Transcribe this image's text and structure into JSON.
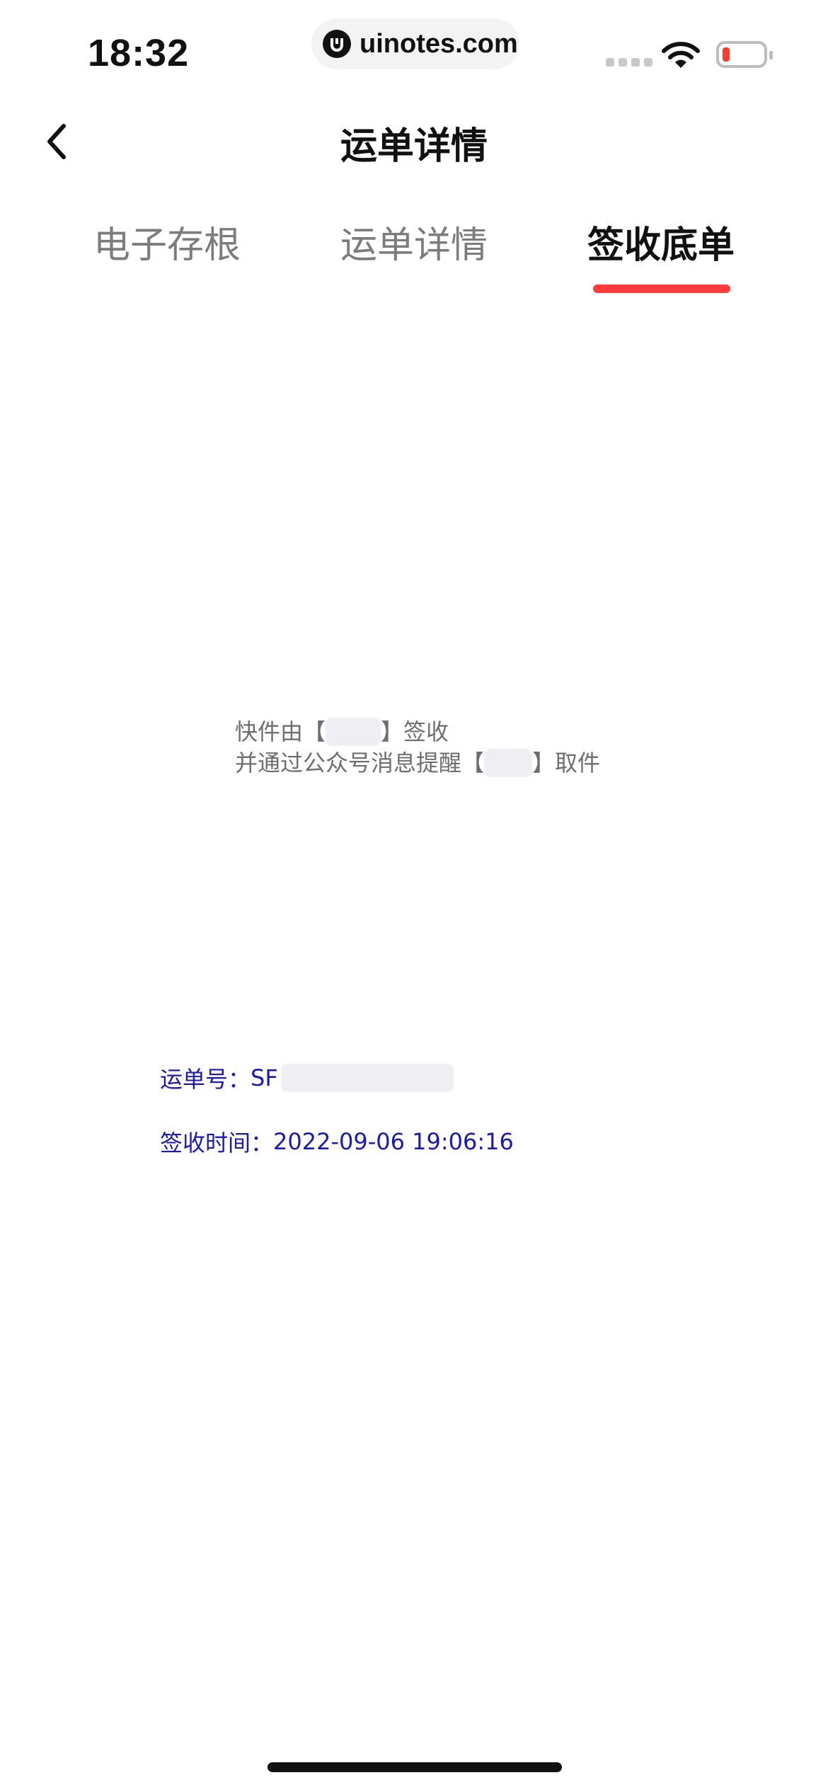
{
  "status_bar": {
    "time": "18:32",
    "url": "uinotes.com",
    "icons": [
      "signal-icon",
      "wifi-icon",
      "battery-icon"
    ],
    "battery_color": "#ff3b30"
  },
  "header": {
    "title": "运单详情",
    "back_icon": "chevron-left-icon"
  },
  "tabs": [
    {
      "label": "电子存根",
      "active": false
    },
    {
      "label": "运单详情",
      "active": false
    },
    {
      "label": "签收底单",
      "active": true
    }
  ],
  "accent_color": "#ff3b3b",
  "notice": {
    "line1_prefix": "快件由【",
    "line1_suffix": "】签收",
    "line2_prefix": "并通过公众号消息提醒【",
    "line2_suffix": "】取件"
  },
  "waybill": {
    "label": "运单号：",
    "prefix": "SF"
  },
  "sign_time": {
    "label": "签收时间：",
    "value": "2022-09-06 19:06:16"
  }
}
